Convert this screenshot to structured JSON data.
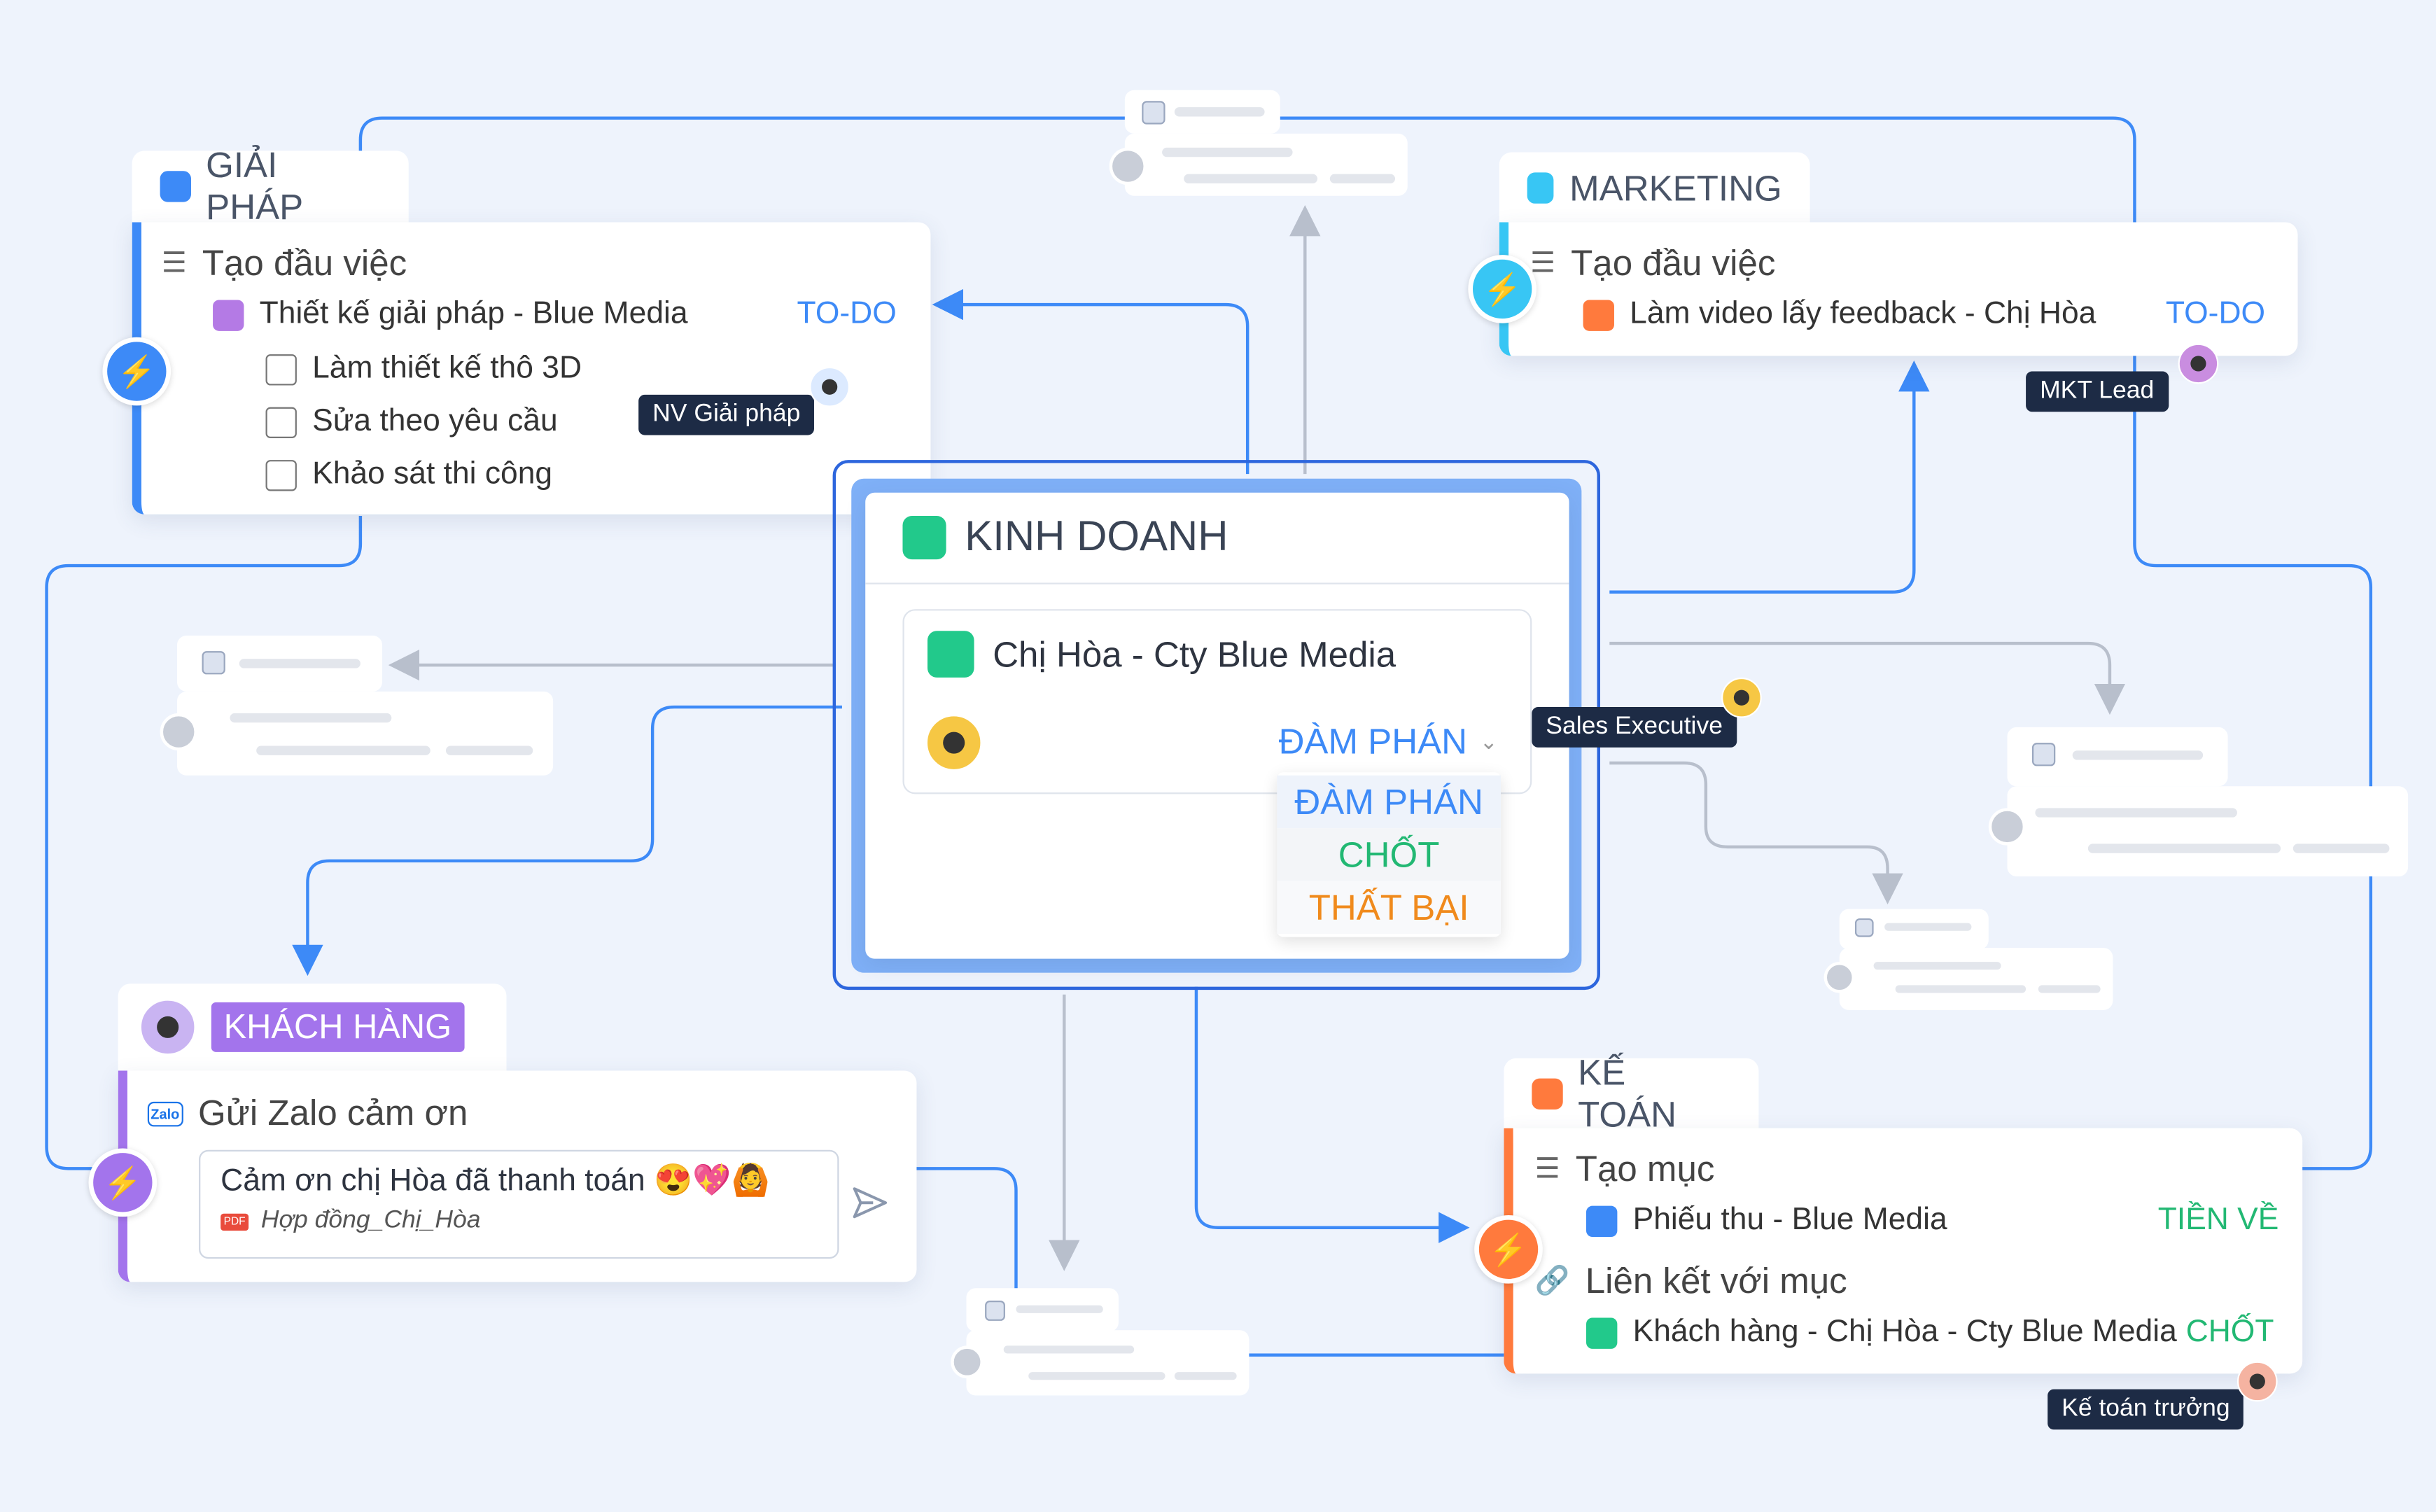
{
  "colors": {
    "giai_phap": "#3d8af7",
    "marketing": "#38c6f4",
    "kinh_doanh": "#22c98b",
    "khach_hang": "#a374ec",
    "ke_toan": "#ff7a3d",
    "todo": "#3d8af7",
    "chot": "#22b873",
    "that_bai": "#f08a1c",
    "connector": "#3d8af7",
    "connector_grey": "#b8bfcc"
  },
  "giai_phap": {
    "title": "GIẢI PHÁP",
    "action": "Tạo đầu việc",
    "task": "Thiết kế giải pháp - Blue Media",
    "status": "TO-DO",
    "checklist": [
      "Làm thiết kế thô 3D",
      "Sửa theo yêu cầu",
      "Khảo sát thi công"
    ],
    "assignee": "NV Giải pháp"
  },
  "marketing": {
    "title": "MARKETING",
    "action": "Tạo đầu việc",
    "task": "Làm video lấy feedback - Chị Hòa",
    "status": "TO-DO",
    "assignee": "MKT Lead"
  },
  "kinh_doanh": {
    "title": "KINH DOANH",
    "deal": "Chị Hòa - Cty Blue Media",
    "stage": "ĐÀM PHÁN",
    "stage_options": [
      "ĐÀM PHÁN",
      "CHỐT",
      "THẤT BẠI"
    ],
    "assignee": "Sales Executive"
  },
  "khach_hang": {
    "title": "KHÁCH HÀNG",
    "action": "Gửi Zalo cảm ơn",
    "zalo_label": "Zalo",
    "message": "Cảm ơn chị Hòa đã thanh toán 😍💖🙆",
    "attachment": "Hợp đồng_Chị_Hòa",
    "pdf_label": "PDF"
  },
  "ke_toan": {
    "title": "KẾ TOÁN",
    "action": "Tạo mục",
    "receipt": "Phiếu thu - Blue Media",
    "receipt_status": "TIỀN VỀ",
    "link_action": "Liên kết với mục",
    "linked": "Khách hàng - Chị Hòa - Cty Blue Media",
    "linked_status": "CHỐT",
    "assignee": "Kế toán trưởng"
  }
}
